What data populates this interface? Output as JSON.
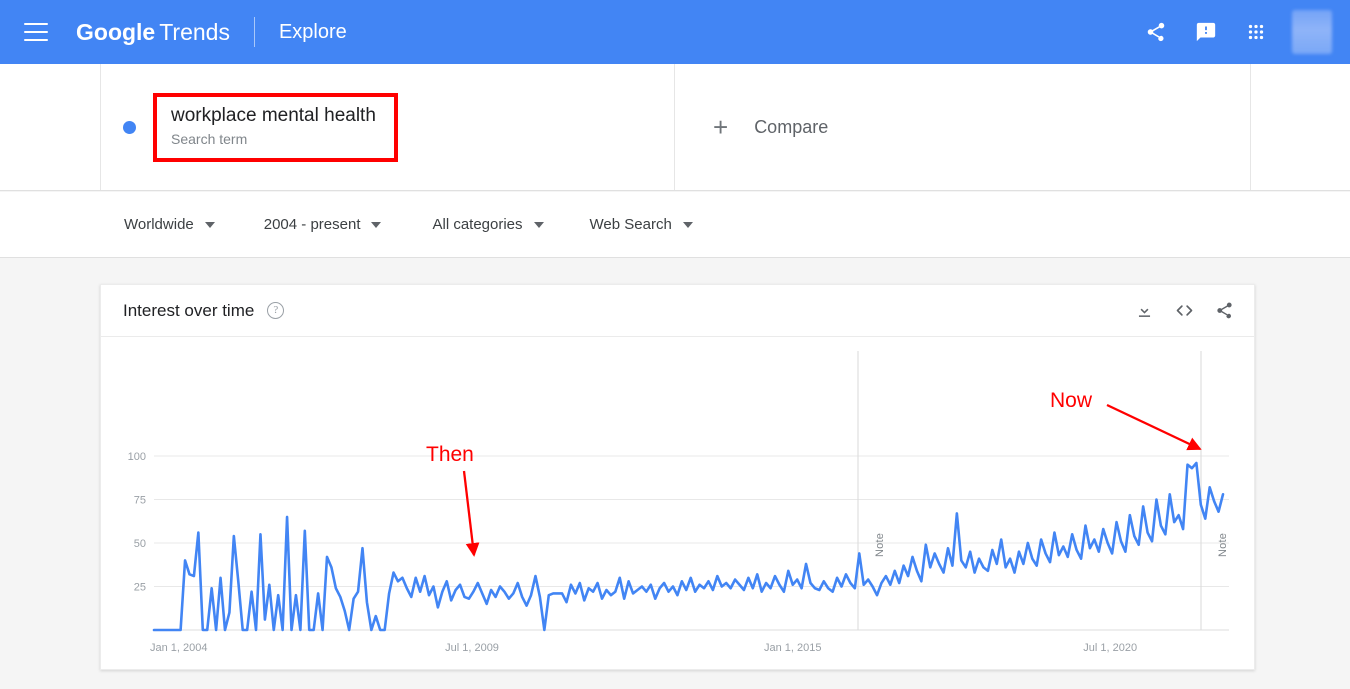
{
  "appbar": {
    "menu_icon": "hamburger-menu-icon",
    "brand_google": "Google",
    "brand_trends": "Trends",
    "explore": "Explore",
    "share_icon": "share-icon",
    "feedback_icon": "feedback-icon",
    "apps_icon": "apps-grid-icon",
    "avatar": "user-avatar",
    "bg_color": "#4285f4"
  },
  "search": {
    "term": "workplace mental health",
    "subtitle": "Search term",
    "dot_color": "#4285f4",
    "highlight_color": "#ff0000",
    "compare_plus": "+",
    "compare_label": "Compare"
  },
  "filters": [
    {
      "label": "Worldwide"
    },
    {
      "label": "2004 - present"
    },
    {
      "label": "All categories"
    },
    {
      "label": "Web Search"
    }
  ],
  "card": {
    "title": "Interest over time",
    "help_icon": "help-question-icon",
    "download_icon": "download-icon",
    "embed_icon": "embed-code-icon",
    "share_icon": "share-icon"
  },
  "annotations": [
    {
      "label": "Then",
      "color": "#ff0000"
    },
    {
      "label": "Now",
      "color": "#ff0000"
    }
  ],
  "notes": [
    {
      "label": "Note"
    },
    {
      "label": "Note"
    }
  ],
  "chart_data": {
    "type": "line",
    "title": "Interest over time",
    "xlabel": "",
    "ylabel": "",
    "ylim": [
      0,
      100
    ],
    "yticks": [
      25,
      50,
      75,
      100
    ],
    "grid": true,
    "legend": false,
    "line_color": "#4285f4",
    "x_range": [
      "Jan 1, 2004",
      "Jul 1, 2022"
    ],
    "xticks": [
      "Jan 1, 2004",
      "Jul 1, 2009",
      "Jan 1, 2015",
      "Jul 1, 2020"
    ],
    "series": [
      {
        "name": "workplace mental health",
        "values": [
          0,
          0,
          0,
          0,
          0,
          0,
          0,
          40,
          32,
          31,
          56,
          0,
          0,
          24,
          0,
          30,
          0,
          10,
          54,
          28,
          0,
          0,
          22,
          0,
          55,
          6,
          26,
          0,
          20,
          0,
          65,
          0,
          20,
          0,
          57,
          0,
          0,
          21,
          0,
          42,
          36,
          24,
          19,
          11,
          0,
          18,
          22,
          47,
          16,
          0,
          8,
          0,
          0,
          21,
          33,
          28,
          30,
          24,
          19,
          30,
          22,
          31,
          20,
          25,
          13,
          22,
          28,
          17,
          23,
          26,
          19,
          18,
          22,
          27,
          21,
          15,
          23,
          19,
          25,
          22,
          18,
          21,
          27,
          19,
          14,
          20,
          31,
          19,
          0,
          20,
          21,
          21,
          21,
          16,
          26,
          21,
          27,
          17,
          24,
          22,
          27,
          18,
          23,
          20,
          22,
          30,
          18,
          28,
          21,
          23,
          25,
          22,
          26,
          18,
          24,
          27,
          22,
          25,
          20,
          28,
          23,
          30,
          22,
          26,
          24,
          28,
          23,
          31,
          25,
          27,
          24,
          29,
          26,
          23,
          30,
          24,
          32,
          22,
          27,
          24,
          31,
          26,
          22,
          34,
          26,
          29,
          24,
          38,
          27,
          24,
          23,
          28,
          24,
          22,
          30,
          25,
          32,
          27,
          24,
          44,
          26,
          29,
          25,
          20,
          27,
          31,
          26,
          34,
          27,
          37,
          31,
          42,
          34,
          28,
          49,
          36,
          44,
          38,
          33,
          47,
          37,
          67,
          40,
          36,
          45,
          33,
          41,
          36,
          34,
          46,
          38,
          52,
          36,
          41,
          33,
          45,
          38,
          50,
          41,
          37,
          52,
          44,
          39,
          56,
          43,
          48,
          42,
          55,
          46,
          41,
          60,
          47,
          52,
          45,
          58,
          50,
          44,
          62,
          51,
          45,
          66,
          54,
          49,
          71,
          56,
          51,
          75,
          60,
          55,
          78,
          62,
          66,
          58,
          95,
          93,
          96,
          72,
          64,
          82,
          74,
          68,
          78
        ]
      }
    ]
  }
}
